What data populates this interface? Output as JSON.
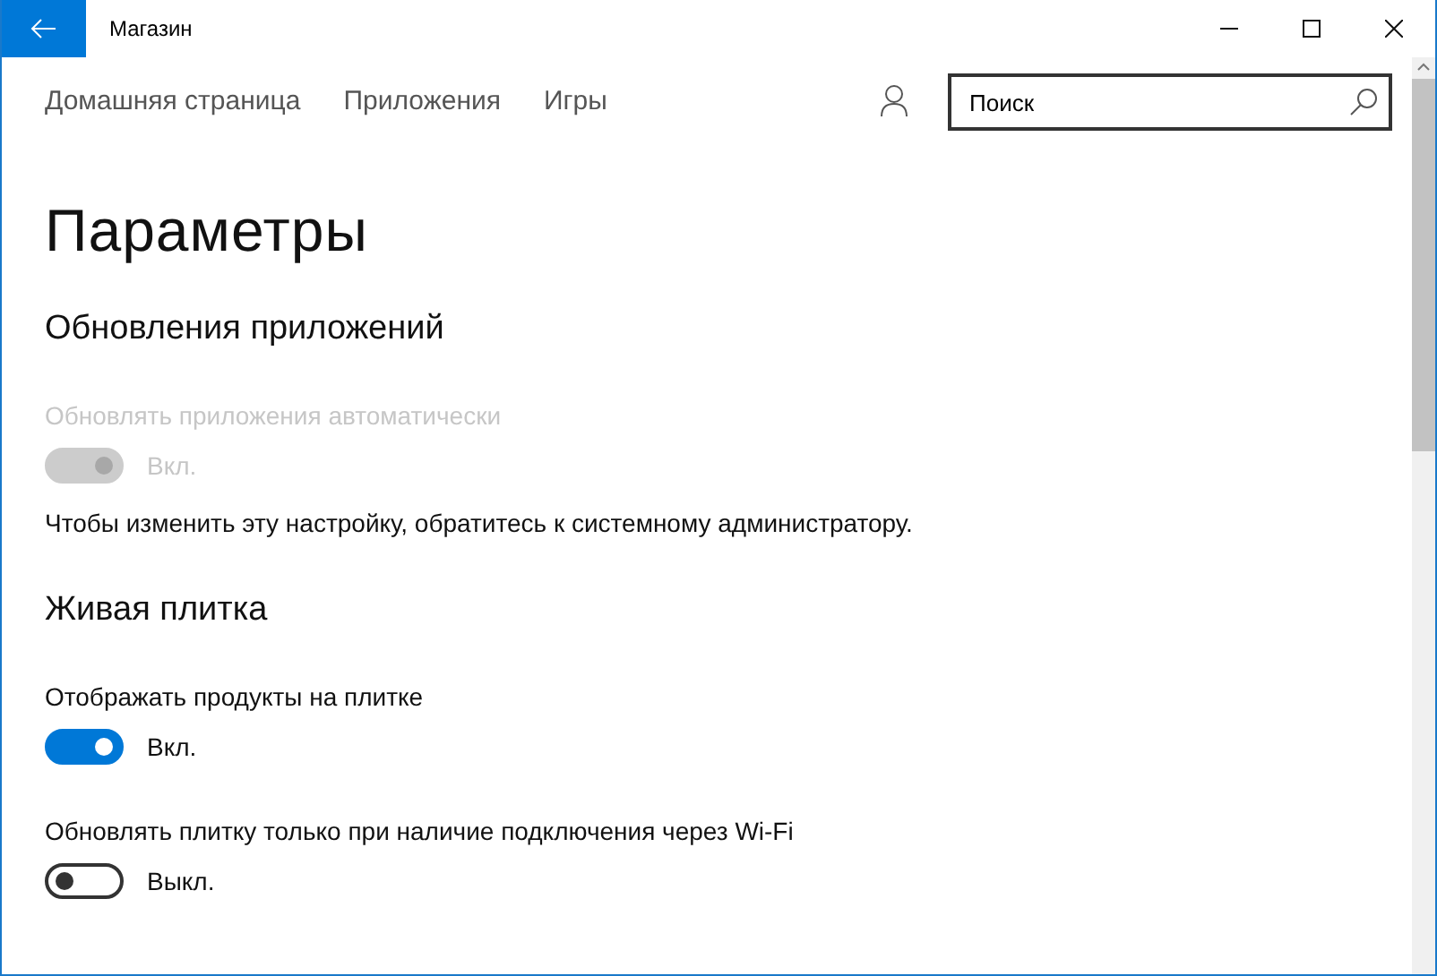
{
  "window": {
    "title": "Магазин"
  },
  "nav": [
    {
      "label": "Домашняя страница",
      "selected": false
    },
    {
      "label": "Приложения",
      "selected": false
    },
    {
      "label": "Игры",
      "selected": false
    }
  ],
  "search": {
    "placeholder": "Поиск"
  },
  "page_title": "Параметры",
  "sections": [
    {
      "heading": "Обновления приложений",
      "items": [
        {
          "kind": "toggle",
          "label": "Обновлять приложения автоматически",
          "on": true,
          "disabled": true,
          "state_text": "Вкл."
        },
        {
          "kind": "note",
          "text": "Чтобы изменить эту настройку, обратитесь к системному администратору."
        }
      ]
    },
    {
      "heading": "Живая плитка",
      "items": [
        {
          "kind": "toggle",
          "label": "Отображать продукты на плитке",
          "on": true,
          "disabled": false,
          "state_text": "Вкл."
        },
        {
          "kind": "toggle",
          "label": "Обновлять плитку только при наличие подключения через Wi-Fi",
          "on": false,
          "disabled": false,
          "state_text": "Выкл."
        }
      ]
    }
  ]
}
